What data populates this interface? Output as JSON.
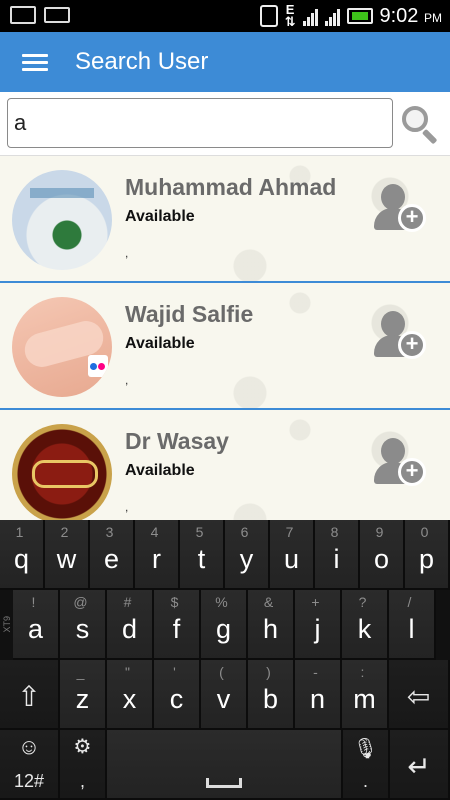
{
  "status_bar": {
    "time": "9:02",
    "ampm": "PM",
    "network_letter": "E",
    "icons": [
      "screenshot-icon",
      "keyboard-icon",
      "vibrate-icon",
      "data-icon",
      "signal-icon",
      "signal-icon",
      "battery-charging-icon"
    ]
  },
  "app_bar": {
    "title": "Search User",
    "menu_icon": "hamburger-menu-icon"
  },
  "search": {
    "value": "a",
    "button_icon": "search-icon"
  },
  "users": [
    {
      "name": "Muhammad Ahmad",
      "status": "Available",
      "sub": ",",
      "action_icon": "add-user-icon"
    },
    {
      "name": "Wajid Salfie",
      "status": "Available",
      "sub": ",",
      "action_icon": "add-user-icon"
    },
    {
      "name": "Dr Wasay",
      "status": "Available",
      "sub": ",",
      "action_icon": "add-user-icon"
    }
  ],
  "keyboard": {
    "row1": [
      {
        "key": "q",
        "alt": "1"
      },
      {
        "key": "w",
        "alt": "2"
      },
      {
        "key": "e",
        "alt": "3"
      },
      {
        "key": "r",
        "alt": "4"
      },
      {
        "key": "t",
        "alt": "5"
      },
      {
        "key": "y",
        "alt": "6"
      },
      {
        "key": "u",
        "alt": "7"
      },
      {
        "key": "i",
        "alt": "8"
      },
      {
        "key": "o",
        "alt": "9"
      },
      {
        "key": "p",
        "alt": "0"
      }
    ],
    "row2": [
      {
        "key": "a",
        "alt": "!"
      },
      {
        "key": "s",
        "alt": "@"
      },
      {
        "key": "d",
        "alt": "#"
      },
      {
        "key": "f",
        "alt": "$"
      },
      {
        "key": "g",
        "alt": "%"
      },
      {
        "key": "h",
        "alt": "&"
      },
      {
        "key": "j",
        "alt": "+"
      },
      {
        "key": "k",
        "alt": "?"
      },
      {
        "key": "l",
        "alt": "/"
      }
    ],
    "row2_side_label": "XT9",
    "row3": [
      {
        "key": "z",
        "alt": "_"
      },
      {
        "key": "x",
        "alt": "\""
      },
      {
        "key": "c",
        "alt": "'"
      },
      {
        "key": "v",
        "alt": "("
      },
      {
        "key": "b",
        "alt": ")"
      },
      {
        "key": "n",
        "alt": "-"
      },
      {
        "key": "m",
        "alt": ":"
      }
    ],
    "shift_icon": "shift-arrow-icon",
    "backspace_icon": "backspace-arrow-icon",
    "symbols_label": "12#",
    "emoji_icon": "emoji-icon",
    "settings_icon": "gear-icon",
    "comma_label": ",",
    "mic_icon": "microphone-icon",
    "period_label": ".",
    "enter_icon": "enter-arrow-icon"
  }
}
